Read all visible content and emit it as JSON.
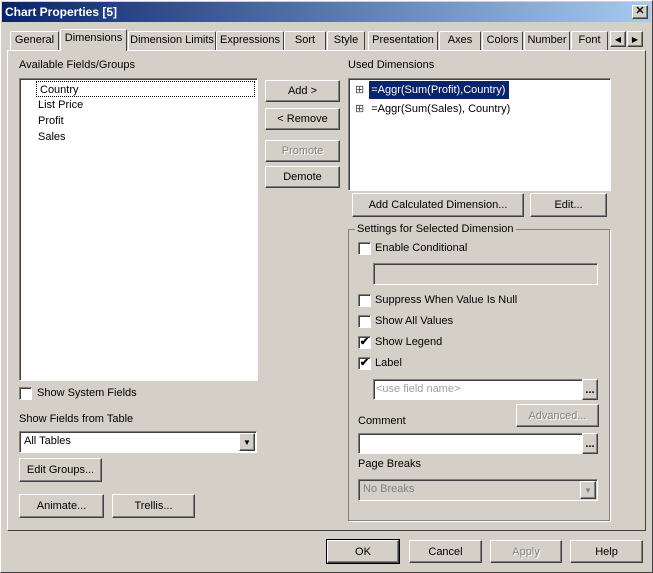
{
  "window": {
    "title": "Chart Properties [5]",
    "close_icon": "close-icon"
  },
  "tabs": [
    {
      "label": "General"
    },
    {
      "label": "Dimensions",
      "selected": true
    },
    {
      "label": "Dimension Limits"
    },
    {
      "label": "Expressions"
    },
    {
      "label": "Sort"
    },
    {
      "label": "Style"
    },
    {
      "label": "Presentation"
    },
    {
      "label": "Axes"
    },
    {
      "label": "Colors"
    },
    {
      "label": "Number"
    },
    {
      "label": "Font"
    }
  ],
  "tab_scroll": {
    "left": "◀",
    "right": "▶"
  },
  "available": {
    "label": "Available Fields/Groups",
    "items": [
      "Country",
      "List Price",
      "Profit",
      "Sales"
    ],
    "selected": "Country"
  },
  "show_system_fields": {
    "label": "Show System Fields",
    "checked": false
  },
  "show_fields_from_table": {
    "label": "Show Fields from Table",
    "value": "All Tables"
  },
  "buttons": {
    "edit_groups": "Edit Groups...",
    "animate": "Animate...",
    "trellis": "Trellis...",
    "add": "Add >",
    "remove": "< Remove",
    "promote": "Promote",
    "demote": "Demote",
    "add_calculated": "Add Calculated Dimension...",
    "edit": "Edit...",
    "advanced": "Advanced...",
    "ellipsis": "...",
    "ok": "OK",
    "cancel": "Cancel",
    "apply": "Apply",
    "help": "Help"
  },
  "used": {
    "label": "Used Dimensions",
    "items": [
      "=Aggr(Sum(Profit),Country)",
      "=Aggr(Sum(Sales), Country)"
    ],
    "expand_icon": "⊞"
  },
  "settings": {
    "title": "Settings for Selected Dimension",
    "enable_conditional": {
      "label": "Enable Conditional",
      "checked": false
    },
    "suppress_null": {
      "label": "Suppress When Value Is Null",
      "checked": false
    },
    "show_all_values": {
      "label": "Show All Values",
      "checked": false
    },
    "show_legend": {
      "label": "Show Legend",
      "checked": true
    },
    "label": {
      "label": "Label",
      "checked": true,
      "placeholder": "<use field name>"
    },
    "comment": {
      "label": "Comment",
      "value": ""
    },
    "page_breaks": {
      "label": "Page Breaks",
      "value": "No Breaks"
    }
  },
  "check_mark": "✔"
}
